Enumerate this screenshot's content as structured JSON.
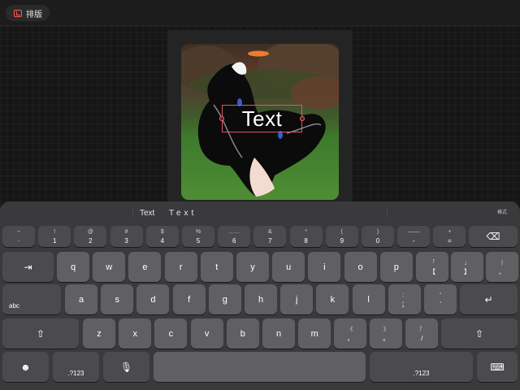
{
  "toolbar": {
    "layout_label": "排版"
  },
  "canvas": {
    "text": "Text"
  },
  "candidates": {
    "first": "Text",
    "second": "Text"
  },
  "format_label": "格式",
  "keyboard": {
    "row_numbers": [
      {
        "up": "~",
        "down": "·"
      },
      {
        "up": "!",
        "down": "1"
      },
      {
        "up": "@",
        "down": "2"
      },
      {
        "up": "#",
        "down": "3"
      },
      {
        "up": "$",
        "down": "4"
      },
      {
        "up": "%",
        "down": "5"
      },
      {
        "up": "……",
        "down": "6"
      },
      {
        "up": "&",
        "down": "7"
      },
      {
        "up": "*",
        "down": "8"
      },
      {
        "up": "(",
        "down": "9"
      },
      {
        "up": ")",
        "down": "0"
      },
      {
        "up": "——",
        "down": "-"
      },
      {
        "up": "+",
        "down": "="
      }
    ],
    "row_q": [
      "q",
      "w",
      "e",
      "r",
      "t",
      "y",
      "u",
      "i",
      "o",
      "p"
    ],
    "row_q_punct": [
      {
        "up": "「",
        "down": "【"
      },
      {
        "up": "」",
        "down": "】"
      },
      {
        "up": "|",
        "down": "、"
      }
    ],
    "row_a_label": "abc",
    "row_a": [
      "a",
      "s",
      "d",
      "f",
      "g",
      "h",
      "j",
      "k",
      "l"
    ],
    "row_a_punct": [
      {
        "up": "：",
        "down": "；"
      },
      {
        "up": "“",
        "down": "‘"
      }
    ],
    "row_z": [
      "z",
      "x",
      "c",
      "v",
      "b",
      "n",
      "m"
    ],
    "row_z_punct": [
      {
        "up": "《",
        "down": "，"
      },
      {
        "up": "》",
        "down": "。"
      },
      {
        "up": "？",
        "down": "/"
      }
    ],
    "mode_left": ".?123",
    "mode_right": ".?123"
  },
  "icons": {
    "delete": "delete-icon",
    "tab": "tab-icon",
    "return": "return-icon",
    "shift": "shift-icon",
    "emoji": "emoji-icon",
    "mic": "mic-icon",
    "hide_keyboard": "keyboard-hide-icon"
  },
  "colors": {
    "accent": "#ff5e57",
    "selection": "#e0566a",
    "key": "#606062",
    "key_dark": "#4b4b4d",
    "panel": "#3a3a3c"
  }
}
